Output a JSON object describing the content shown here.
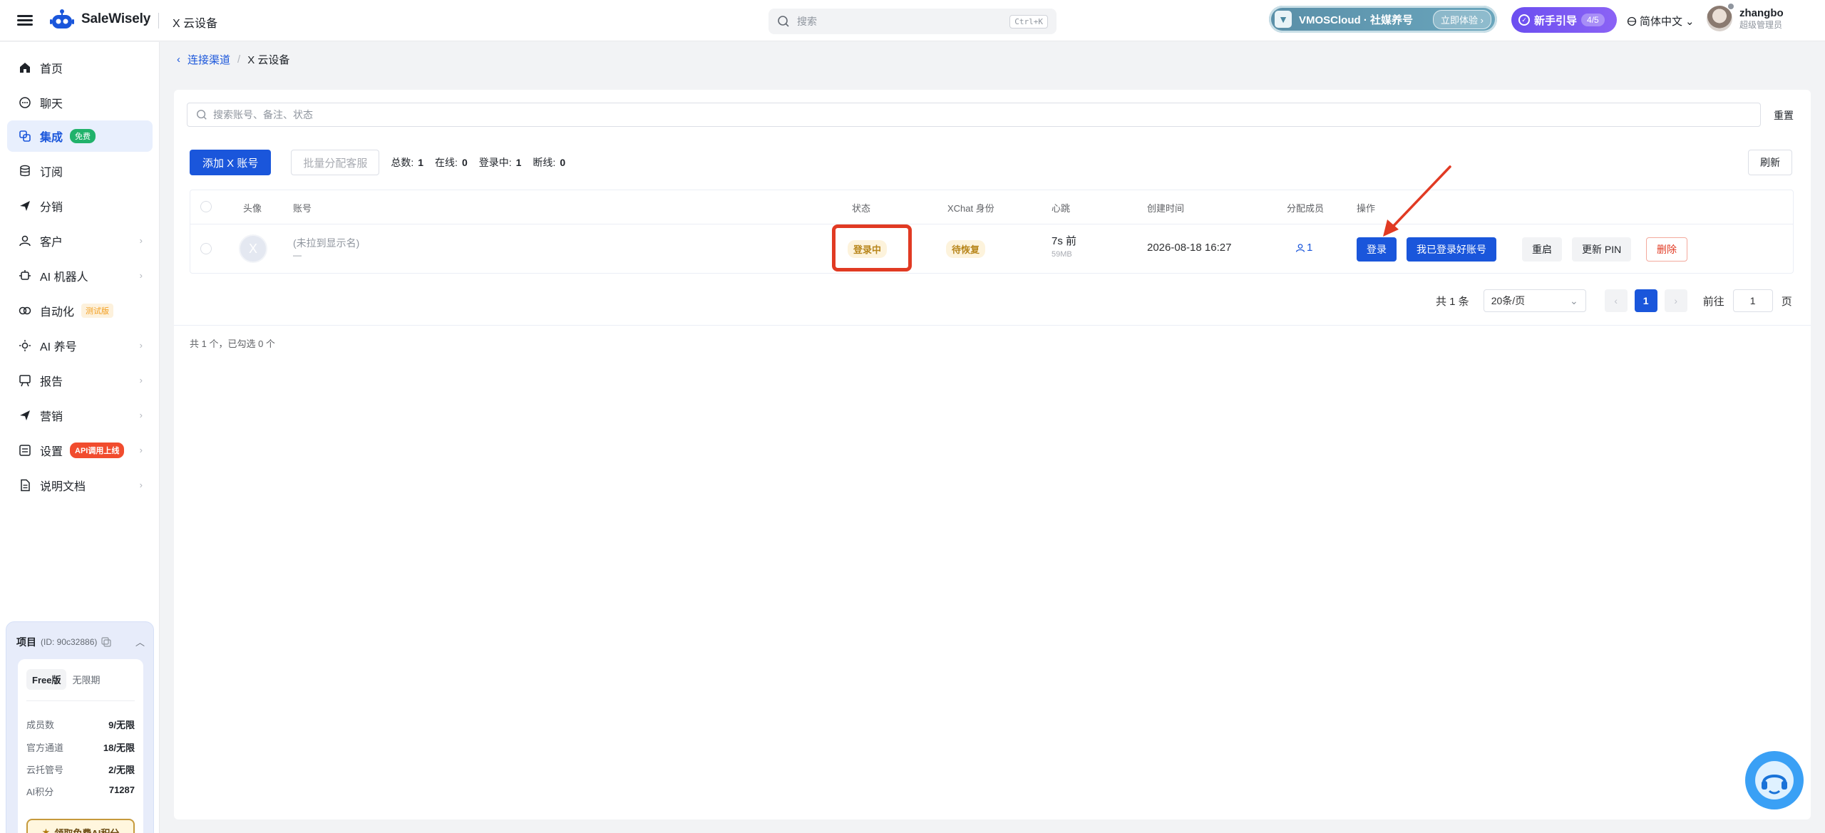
{
  "header": {
    "brand": "SaleWisely",
    "page_title": "X 云设备",
    "search_placeholder": "搜索",
    "search_shortcut": "Ctrl+K",
    "promo_text": "VMOSCloud · 社媒养号",
    "promo_button": "立即体验",
    "guide_label": "新手引导",
    "guide_progress": "4/5",
    "language": "简体中文",
    "user_name": "zhangbo",
    "user_role": "超级管理员"
  },
  "sidebar": {
    "items": [
      {
        "label": "首页",
        "icon": "home-icon"
      },
      {
        "label": "聊天",
        "icon": "chat-icon"
      },
      {
        "label": "集成",
        "icon": "integration-icon",
        "tag": "免费"
      },
      {
        "label": "订阅",
        "icon": "database-icon"
      },
      {
        "label": "分销",
        "icon": "send-icon"
      },
      {
        "label": "客户",
        "icon": "user-icon"
      },
      {
        "label": "AI 机器人",
        "icon": "robot-icon"
      },
      {
        "label": "自动化",
        "icon": "automation-icon",
        "tag": "测试版"
      },
      {
        "label": "AI 养号",
        "icon": "sun-icon"
      },
      {
        "label": "报告",
        "icon": "report-icon"
      },
      {
        "label": "营销",
        "icon": "send-icon"
      },
      {
        "label": "设置",
        "icon": "settings-icon",
        "tag": "API调用上线"
      },
      {
        "label": "说明文档",
        "icon": "document-icon"
      }
    ],
    "project": {
      "title": "项目",
      "id": "(ID: 90c32886)",
      "plan": "Free版",
      "term": "无限期",
      "stats": [
        {
          "label": "成员数",
          "value": "9/无限"
        },
        {
          "label": "官方通道",
          "value": "18/无限"
        },
        {
          "label": "云托管号",
          "value": "2/无限"
        },
        {
          "label": "AI积分",
          "value": "71287"
        }
      ],
      "claim_button": "领取免费AI积分"
    }
  },
  "breadcrumb": {
    "parent": "连接渠道",
    "separator": "/",
    "current": "X 云设备"
  },
  "main": {
    "search_placeholder": "搜索账号、备注、状态",
    "reset_label": "重置",
    "add_button": "添加 X 账号",
    "batch_button": "批量分配客服",
    "counts": {
      "total_label": "总数:",
      "total": "1",
      "online_label": "在线:",
      "online": "0",
      "logging_label": "登录中:",
      "logging": "1",
      "offline_label": "断线:",
      "offline": "0"
    },
    "refresh_label": "刷新",
    "table": {
      "headers": [
        "头像",
        "账号",
        "状态",
        "XChat 身份",
        "心跳",
        "创建时间",
        "分配成员",
        "操作"
      ],
      "rows": [
        {
          "avatar_letter": "X",
          "account_name": "(未拉到显示名)",
          "account_sub": "—",
          "status": "登录中",
          "xchat": "待恢复",
          "heartbeat": "7s 前",
          "heartbeat_sub": "59MB",
          "created": "2026-08-18 16:27",
          "members": "1",
          "actions": [
            "登录",
            "我已登录好账号",
            "重启",
            "更新 PIN",
            "删除"
          ]
        }
      ]
    },
    "pagination": {
      "total": "共 1 条",
      "page_size": "20条/页",
      "current_page": "1",
      "goto_label": "前往",
      "goto_value": "1",
      "page_suffix": "页"
    },
    "selection_info": "共 1 个，已勾选 0 个"
  },
  "colors": {
    "primary": "#1a56db",
    "annotation": "#e13a23",
    "warning_bg": "#fdf3dc"
  }
}
